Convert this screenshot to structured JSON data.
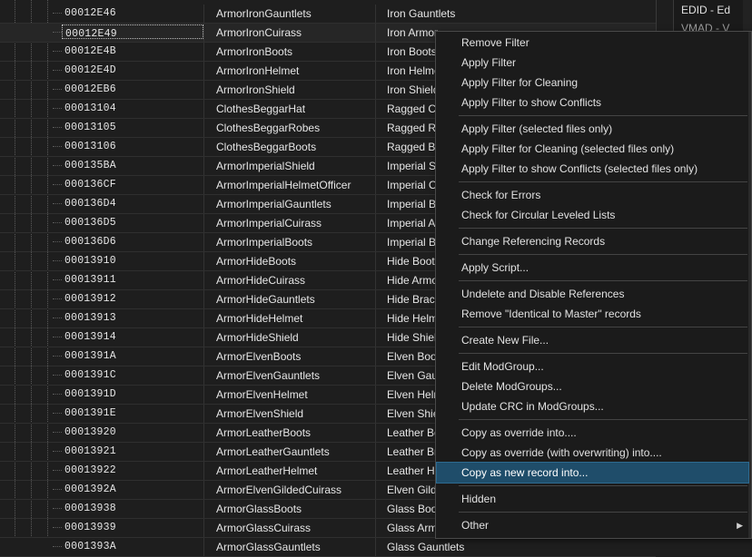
{
  "table": {
    "rows": [
      {
        "formid": "00012E46",
        "editor_id": "ArmorIronGauntlets",
        "name": "Iron Gauntlets"
      },
      {
        "formid": "00012E49",
        "editor_id": "ArmorIronCuirass",
        "name": "Iron Armor",
        "selected": true
      },
      {
        "formid": "00012E4B",
        "editor_id": "ArmorIronBoots",
        "name": "Iron Boots"
      },
      {
        "formid": "00012E4D",
        "editor_id": "ArmorIronHelmet",
        "name": "Iron Helmet"
      },
      {
        "formid": "00012EB6",
        "editor_id": "ArmorIronShield",
        "name": "Iron Shield"
      },
      {
        "formid": "00013104",
        "editor_id": "ClothesBeggarHat",
        "name": "Ragged Cap"
      },
      {
        "formid": "00013105",
        "editor_id": "ClothesBeggarRobes",
        "name": "Ragged Robes"
      },
      {
        "formid": "00013106",
        "editor_id": "ClothesBeggarBoots",
        "name": "Ragged Boots"
      },
      {
        "formid": "000135BA",
        "editor_id": "ArmorImperialShield",
        "name": "Imperial Shield"
      },
      {
        "formid": "000136CF",
        "editor_id": "ArmorImperialHelmetOfficer",
        "name": "Imperial Officer's Helmet"
      },
      {
        "formid": "000136D4",
        "editor_id": "ArmorImperialGauntlets",
        "name": "Imperial Bracers"
      },
      {
        "formid": "000136D5",
        "editor_id": "ArmorImperialCuirass",
        "name": "Imperial Armor"
      },
      {
        "formid": "000136D6",
        "editor_id": "ArmorImperialBoots",
        "name": "Imperial Boots"
      },
      {
        "formid": "00013910",
        "editor_id": "ArmorHideBoots",
        "name": "Hide Boots"
      },
      {
        "formid": "00013911",
        "editor_id": "ArmorHideCuirass",
        "name": "Hide Armor"
      },
      {
        "formid": "00013912",
        "editor_id": "ArmorHideGauntlets",
        "name": "Hide Bracers"
      },
      {
        "formid": "00013913",
        "editor_id": "ArmorHideHelmet",
        "name": "Hide Helmet"
      },
      {
        "formid": "00013914",
        "editor_id": "ArmorHideShield",
        "name": "Hide Shield"
      },
      {
        "formid": "0001391A",
        "editor_id": "ArmorElvenBoots",
        "name": "Elven Boots"
      },
      {
        "formid": "0001391C",
        "editor_id": "ArmorElvenGauntlets",
        "name": "Elven Gauntlets"
      },
      {
        "formid": "0001391D",
        "editor_id": "ArmorElvenHelmet",
        "name": "Elven Helmet"
      },
      {
        "formid": "0001391E",
        "editor_id": "ArmorElvenShield",
        "name": "Elven Shield"
      },
      {
        "formid": "00013920",
        "editor_id": "ArmorLeatherBoots",
        "name": "Leather Boots"
      },
      {
        "formid": "00013921",
        "editor_id": "ArmorLeatherGauntlets",
        "name": "Leather Bracers"
      },
      {
        "formid": "00013922",
        "editor_id": "ArmorLeatherHelmet",
        "name": "Leather Helmet"
      },
      {
        "formid": "0001392A",
        "editor_id": "ArmorElvenGildedCuirass",
        "name": "Elven Gilded Armor"
      },
      {
        "formid": "00013938",
        "editor_id": "ArmorGlassBoots",
        "name": "Glass Boots"
      },
      {
        "formid": "00013939",
        "editor_id": "ArmorGlassCuirass",
        "name": "Glass Armor"
      },
      {
        "formid": "0001393A",
        "editor_id": "ArmorGlassGauntlets",
        "name": "Glass Gauntlets"
      }
    ]
  },
  "right_panel": {
    "items": [
      "EDID - Ed",
      "VMAD - V"
    ]
  },
  "context_menu": {
    "groups": [
      [
        {
          "label": "Remove Filter"
        },
        {
          "label": "Apply Filter"
        },
        {
          "label": "Apply Filter for Cleaning"
        },
        {
          "label": "Apply Filter to show Conflicts"
        }
      ],
      [
        {
          "label": "Apply Filter (selected files only)"
        },
        {
          "label": "Apply Filter for Cleaning (selected files only)"
        },
        {
          "label": "Apply Filter to show Conflicts (selected files only)"
        }
      ],
      [
        {
          "label": "Check for Errors"
        },
        {
          "label": "Check for Circular Leveled Lists"
        }
      ],
      [
        {
          "label": "Change Referencing Records"
        }
      ],
      [
        {
          "label": "Apply Script..."
        }
      ],
      [
        {
          "label": "Undelete and Disable References"
        },
        {
          "label": "Remove \"Identical to Master\" records"
        }
      ],
      [
        {
          "label": "Create New File..."
        }
      ],
      [
        {
          "label": "Edit ModGroup..."
        },
        {
          "label": "Delete ModGroups..."
        },
        {
          "label": "Update CRC in ModGroups..."
        }
      ],
      [
        {
          "label": "Copy as override into...."
        },
        {
          "label": "Copy as override (with overwriting) into...."
        },
        {
          "label": "Copy as new record into...",
          "highlighted": true
        }
      ],
      [
        {
          "label": "Hidden"
        }
      ],
      [
        {
          "label": "Other",
          "submenu": true
        }
      ]
    ]
  },
  "colors": {
    "background": "#1e1e1e",
    "menu_background": "#1b1b1b",
    "highlight": "#1f4d6a",
    "text": "#e6e6e6"
  },
  "icons": {
    "submenu_arrow": "chevron-right-icon"
  }
}
